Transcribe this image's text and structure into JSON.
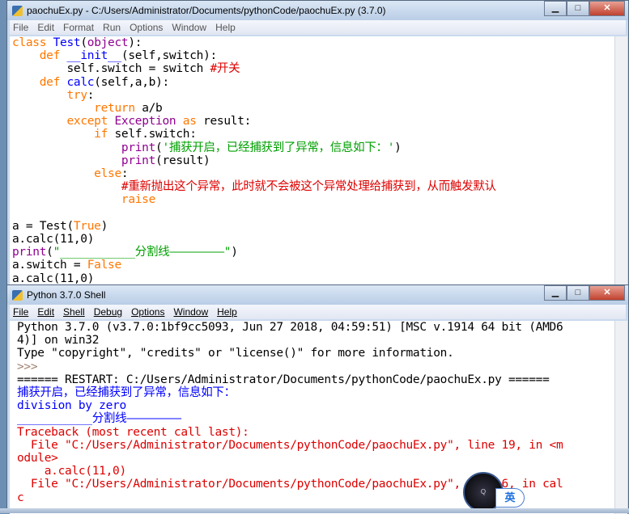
{
  "editor": {
    "title": "paochuEx.py - C:/Users/Administrator/Documents/pythonCode/paochuEx.py (3.7.0)",
    "menu": [
      "File",
      "Edit",
      "Format",
      "Run",
      "Options",
      "Window",
      "Help"
    ],
    "lines": [
      [
        [
          "kw",
          "class "
        ],
        [
          "def",
          "Test"
        ],
        [
          "pl",
          "("
        ],
        [
          "bi",
          "object"
        ],
        [
          "pl",
          "):"
        ]
      ],
      [
        [
          "pl",
          "    "
        ],
        [
          "kw",
          "def "
        ],
        [
          "def",
          "__init__"
        ],
        [
          "pl",
          "(self,switch):"
        ]
      ],
      [
        [
          "pl",
          "        self.switch = switch "
        ],
        [
          "cm",
          "#开关"
        ]
      ],
      [
        [
          "pl",
          "    "
        ],
        [
          "kw",
          "def "
        ],
        [
          "def",
          "calc"
        ],
        [
          "pl",
          "(self,a,b):"
        ]
      ],
      [
        [
          "pl",
          "        "
        ],
        [
          "kw",
          "try"
        ],
        [
          "pl",
          ":"
        ]
      ],
      [
        [
          "pl",
          "            "
        ],
        [
          "kw",
          "return"
        ],
        [
          "pl",
          " a/b"
        ]
      ],
      [
        [
          "pl",
          "        "
        ],
        [
          "kw",
          "except "
        ],
        [
          "bi",
          "Exception"
        ],
        [
          "kw",
          " as"
        ],
        [
          "pl",
          " result:"
        ]
      ],
      [
        [
          "pl",
          "            "
        ],
        [
          "kw",
          "if"
        ],
        [
          "pl",
          " self.switch:"
        ]
      ],
      [
        [
          "pl",
          "                "
        ],
        [
          "bi",
          "print"
        ],
        [
          "pl",
          "("
        ],
        [
          "str",
          "'捕获开启，已经捕获到了异常，信息如下：'"
        ],
        [
          "pl",
          ")"
        ]
      ],
      [
        [
          "pl",
          "                "
        ],
        [
          "bi",
          "print"
        ],
        [
          "pl",
          "(result)"
        ]
      ],
      [
        [
          "pl",
          "            "
        ],
        [
          "kw",
          "else"
        ],
        [
          "pl",
          ":"
        ]
      ],
      [
        [
          "pl",
          "                "
        ],
        [
          "cm",
          "#重新抛出这个异常，此时就不会被这个异常处理给捕获到，从而触发默认"
        ]
      ],
      [
        [
          "pl",
          "                "
        ],
        [
          "kw",
          "raise"
        ]
      ],
      [
        [
          "pl",
          " "
        ]
      ],
      [
        [
          "pl",
          "a = Test("
        ],
        [
          "kw",
          "True"
        ],
        [
          "pl",
          ")"
        ]
      ],
      [
        [
          "pl",
          "a.calc(11,0)"
        ]
      ],
      [
        [
          "bi",
          "print"
        ],
        [
          "pl",
          "("
        ],
        [
          "str",
          "\"___________分割线————————\""
        ],
        [
          "pl",
          ")"
        ]
      ],
      [
        [
          "pl",
          "a.switch = "
        ],
        [
          "kw",
          "False"
        ]
      ],
      [
        [
          "pl",
          "a.calc(11,0)"
        ]
      ]
    ]
  },
  "shell": {
    "title": "Python 3.7.0 Shell",
    "menu": [
      "File",
      "Edit",
      "Shell",
      "Debug",
      "Options",
      "Window",
      "Help"
    ],
    "lines": [
      [
        [
          "pl",
          "Python 3.7.0 (v3.7.0:1bf9cc5093, Jun 27 2018, 04:59:51) [MSC v.1914 64 bit (AMD6"
        ]
      ],
      [
        [
          "pl",
          "4)] on win32"
        ]
      ],
      [
        [
          "pl",
          "Type \"copyright\", \"credits\" or \"license()\" for more information."
        ]
      ],
      [
        [
          "pr",
          ">>> "
        ]
      ],
      [
        [
          "pl",
          "====== RESTART: C:/Users/Administrator/Documents/pythonCode/paochuEx.py ======"
        ]
      ],
      [
        [
          "out",
          "捕获开启，已经捕获到了异常，信息如下："
        ]
      ],
      [
        [
          "out",
          "division by zero"
        ]
      ],
      [
        [
          "out",
          "___________分割线————————"
        ]
      ],
      [
        [
          "err",
          "Traceback (most recent call last):"
        ]
      ],
      [
        [
          "err",
          "  File \"C:/Users/Administrator/Documents/pythonCode/paochuEx.py\", line 19, in <m"
        ]
      ],
      [
        [
          "err",
          "odule>"
        ]
      ],
      [
        [
          "err",
          "    a.calc(11,0)"
        ]
      ],
      [
        [
          "err",
          "  File \"C:/Users/Administrator/Documents/pythonCode/paochuEx.py\", line 6, in cal"
        ]
      ],
      [
        [
          "err",
          "c"
        ]
      ]
    ]
  },
  "overlay": {
    "ime_label": "英"
  },
  "colors": {
    "keyword": "#ff7700",
    "builtin": "#900090",
    "string": "#00a000",
    "comment": "#dd0000",
    "defname": "#0000ff",
    "output": "#0000ff",
    "error": "#dd0000"
  }
}
